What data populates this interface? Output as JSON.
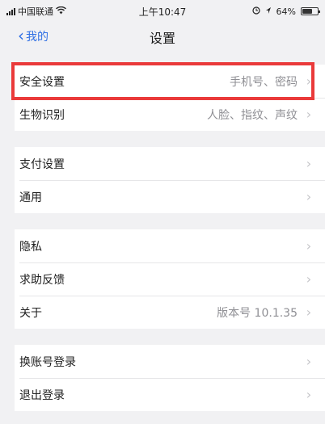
{
  "status_bar": {
    "carrier": "中国联通",
    "time": "上午10:47",
    "battery": "64%",
    "battery_level": 0.64
  },
  "nav": {
    "back_label": "我的",
    "title": "设置"
  },
  "groups": [
    [
      {
        "label": "安全设置",
        "value": "手机号、密码"
      },
      {
        "label": "生物识别",
        "value": "人脸、指纹、声纹"
      }
    ],
    [
      {
        "label": "支付设置",
        "value": ""
      },
      {
        "label": "通用",
        "value": ""
      }
    ],
    [
      {
        "label": "隐私",
        "value": ""
      },
      {
        "label": "求助反馈",
        "value": ""
      },
      {
        "label": "关于",
        "value": "版本号 10.1.35"
      }
    ],
    [
      {
        "label": "换账号登录",
        "value": ""
      },
      {
        "label": "退出登录",
        "value": ""
      }
    ]
  ],
  "highlight_color": "#ea3a3a",
  "accent_color": "#2f6fe4"
}
